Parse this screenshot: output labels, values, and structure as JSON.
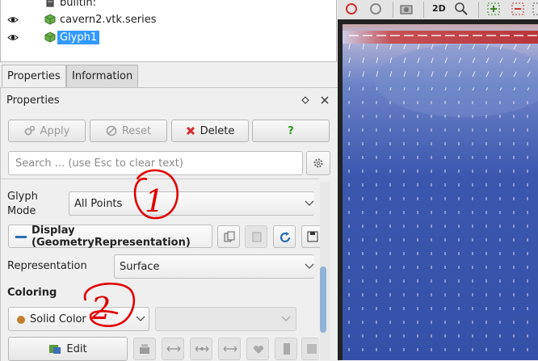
{
  "pipeline": {
    "items": [
      {
        "label": "builtin:",
        "icon": "server-icon"
      },
      {
        "label": "cavern2.vtk.series",
        "icon": "dataset-cube-icon",
        "visible": true
      },
      {
        "label": "Glyph1",
        "icon": "filter-cube-icon",
        "visible": true,
        "selected": true
      }
    ]
  },
  "tabs": [
    {
      "label": "Properties",
      "active": true
    },
    {
      "label": "Information",
      "active": false
    }
  ],
  "properties": {
    "title": "Properties",
    "buttons": {
      "apply": "Apply",
      "reset": "Reset",
      "delete": "Delete",
      "help": "?"
    },
    "search": {
      "placeholder": "Search ... (use Esc to clear text)"
    },
    "glyph_mode": {
      "label": "Glyph Mode",
      "value": "All Points"
    },
    "display_section": "Display (GeometryRepresentation)",
    "representation": {
      "label": "Representation",
      "value": "Surface"
    },
    "coloring": {
      "label": "Coloring",
      "value": "Solid Color",
      "secondary_value": ""
    },
    "edit_button": "Edit"
  },
  "view": {
    "toolbar_2d": "2D"
  },
  "annotations": [
    "1",
    "2"
  ],
  "colors": {
    "selection": "#3399ff",
    "delete_red": "#d52b2b",
    "help_green": "#2a9a1c",
    "annotation_red": "#e00000",
    "view_blue": "#2f4fa8",
    "solid_color_swatch": "#c08030"
  }
}
